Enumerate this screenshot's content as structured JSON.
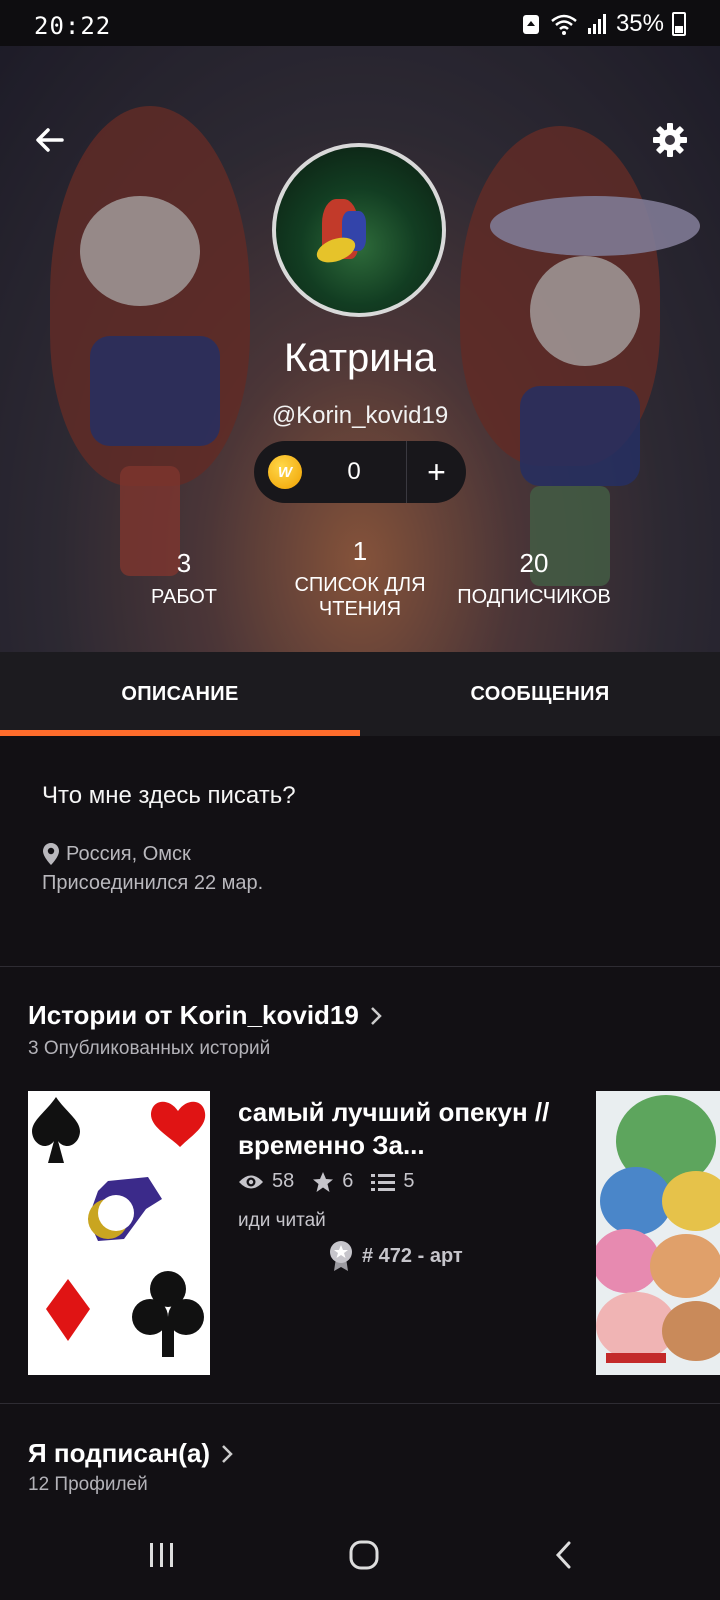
{
  "status_bar": {
    "time": "20:22",
    "battery": "35%"
  },
  "header": {
    "name": "Катрина",
    "handle": "@Korin_kovid19",
    "coins": {
      "count": "0",
      "plus": "+"
    },
    "stats": [
      {
        "value": "3",
        "label": "РАБОТ"
      },
      {
        "value": "1",
        "label": "СПИСОК ДЛЯ ЧТЕНИЯ"
      },
      {
        "value": "20",
        "label": "ПОДПИСЧИКОВ"
      }
    ]
  },
  "tabs": [
    {
      "label": "ОПИСАНИЕ",
      "active": true
    },
    {
      "label": "СООБЩЕНИЯ",
      "active": false
    }
  ],
  "about": {
    "text": "Что мне здесь писать?",
    "location": "Россия, Омск",
    "joined": "Присоединился 22 мар."
  },
  "stories": {
    "title": "Истории от Korin_kovid19",
    "subtitle": "3 Опубликованных историй",
    "items": [
      {
        "title": "самый лучший опекун  //временно За...",
        "views": "58",
        "votes": "6",
        "parts": "5",
        "tag": "иди читай",
        "rank": "# 472 - арт"
      }
    ]
  },
  "following": {
    "title": "Я подписан(а)",
    "subtitle": "12 Профилей"
  },
  "colors": {
    "accent": "#ff6c2c",
    "background": "#121014",
    "tab_bar": "#1c1b1f"
  }
}
